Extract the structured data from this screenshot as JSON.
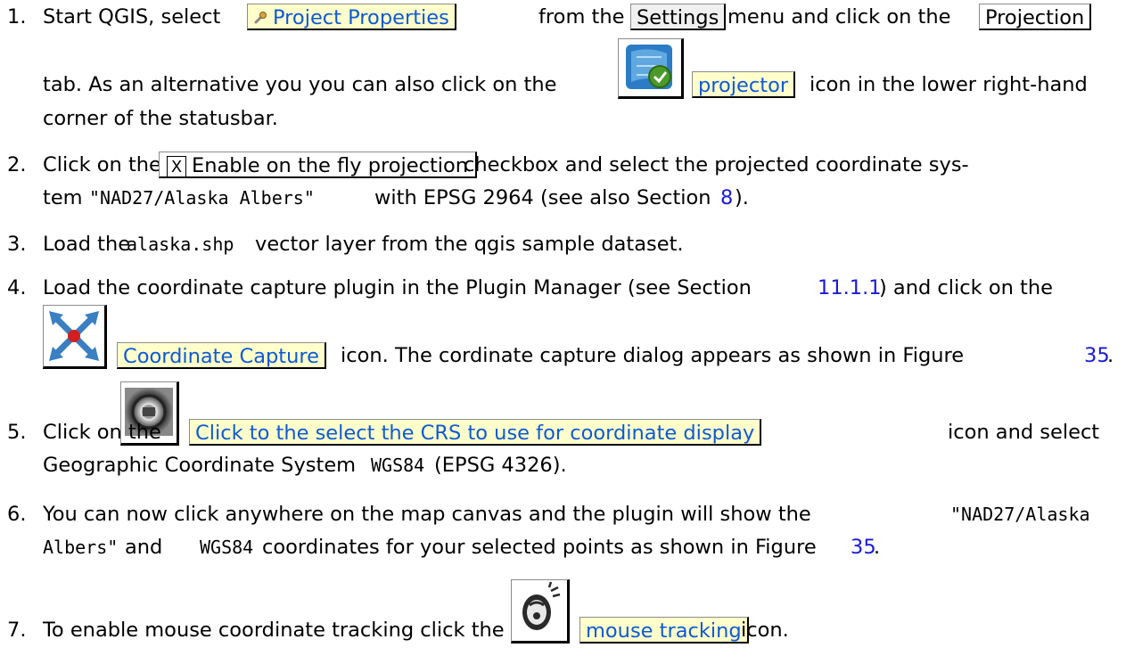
{
  "steps": [
    {
      "number": "1.",
      "line1_a": "Start QGIS, select",
      "btn_project_properties": "Project Properties",
      "line1_b": "from the",
      "menu_settings": "Settings",
      "line1_c": "menu and click on the",
      "tab_projection": "Projection",
      "line2_a": "tab. As an alternative you you can also click on the",
      "label_projector": "projector",
      "line2_b": "icon in the lower right-hand",
      "line3": "corner of the statusbar."
    },
    {
      "number": "2.",
      "line1_a": "Click on the",
      "checkbox_mark": "X",
      "checkbox_label": "Enable on the fly projection",
      "line1_b": "checkbox and select the projected coordinate sys-",
      "line2_a": "tem",
      "crs_name": "\"NAD27/Alaska Albers\"",
      "line2_b": "with EPSG 2964 (see also Section",
      "section_ref": "8",
      "line2_c": ")."
    },
    {
      "number": "3.",
      "text_a": "Load the",
      "file_name": "alaska.shp",
      "text_b": "vector layer from the qgis sample dataset."
    },
    {
      "number": "4.",
      "line1_a": "Load the coordinate capture plugin in the Plugin Manager (see Section",
      "section_ref": "11.1.1",
      "line1_b": ") and click on the",
      "label_coordinate_capture": "Coordinate Capture",
      "line2_a": "icon. The cordinate capture dialog appears as shown in Figure",
      "figure_ref": "35",
      "line2_b": "."
    },
    {
      "number": "5.",
      "line1_a": "Click on the",
      "label_crs": "Click to the select the CRS to use for coordinate display",
      "line1_b": "icon and select",
      "line2_a": "Geographic Coordinate System",
      "crs_code": "WGS84",
      "line2_b": "(EPSG 4326)."
    },
    {
      "number": "6.",
      "line1_a": "You can now click anywhere on the map canvas and the plugin will show the",
      "crs_mono_a": "\"NAD27/Alaska",
      "crs_mono_b": "Albers\"",
      "line2_a": "and",
      "crs_code": "WGS84",
      "line2_b": "coordinates for your selected points as shown in Figure",
      "figure_ref": "35",
      "line2_c": "."
    },
    {
      "number": "7.",
      "line1_a": "To enable mouse coordinate tracking click the",
      "label_mouse_tracking": "mouse tracking",
      "line1_b": "icon."
    }
  ],
  "icons": {
    "wrench": "wrench-icon",
    "projector": "projector-globe-icon",
    "coordinate_capture": "coordinate-capture-icon",
    "crs_select": "crs-select-icon",
    "mouse_tracking": "mouse-tracking-icon"
  },
  "colors": {
    "label_background": "#ffffcc",
    "label_text": "#0d59d6",
    "link": "#1a1ad9"
  }
}
